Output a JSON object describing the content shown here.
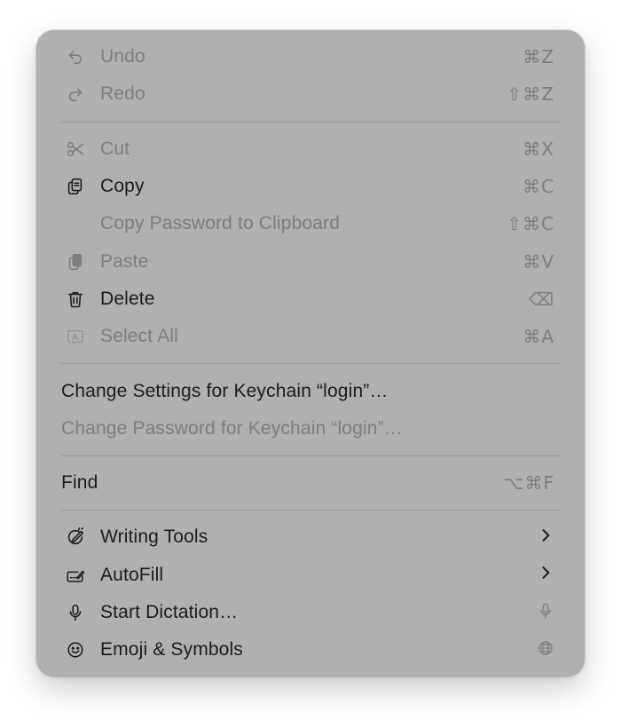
{
  "menu": {
    "groups": [
      {
        "items": [
          {
            "label": "Undo",
            "shortcut": "⌘Z",
            "icon": "undo-icon",
            "enabled": false
          },
          {
            "label": "Redo",
            "shortcut": "⇧⌘Z",
            "icon": "redo-icon",
            "enabled": false
          }
        ]
      },
      {
        "items": [
          {
            "label": "Cut",
            "shortcut": "⌘X",
            "icon": "scissors-icon",
            "enabled": false
          },
          {
            "label": "Copy",
            "shortcut": "⌘C",
            "icon": "copy-icon",
            "enabled": true
          },
          {
            "label": "Copy Password to Clipboard",
            "shortcut": "⇧⌘C",
            "icon": "",
            "enabled": false
          },
          {
            "label": "Paste",
            "shortcut": "⌘V",
            "icon": "paste-icon",
            "enabled": false
          },
          {
            "label": "Delete",
            "shortcut": "⌫",
            "icon": "trash-icon",
            "enabled": true
          },
          {
            "label": "Select All",
            "shortcut": "⌘A",
            "icon": "select-all-icon",
            "enabled": false
          }
        ]
      },
      {
        "items": [
          {
            "label": "Change Settings for Keychain “login”…",
            "shortcut": "",
            "icon": "",
            "enabled": true,
            "noicon": true
          },
          {
            "label": "Change Password for Keychain “login”…",
            "shortcut": "",
            "icon": "",
            "enabled": false,
            "noicon": true
          }
        ]
      },
      {
        "items": [
          {
            "label": "Find",
            "shortcut": "⌥⌘F",
            "icon": "",
            "enabled": true,
            "noicon": true
          }
        ]
      },
      {
        "items": [
          {
            "label": "Writing Tools",
            "shortcut": "",
            "icon": "writing-tools-icon",
            "enabled": true,
            "submenu": true
          },
          {
            "label": "AutoFill",
            "shortcut": "",
            "icon": "autofill-icon",
            "enabled": true,
            "submenu": true
          },
          {
            "label": "Start Dictation…",
            "shortcut": "",
            "icon": "microphone-icon",
            "enabled": true,
            "trailing_icon": "microphone-icon"
          },
          {
            "label": "Emoji & Symbols",
            "shortcut": "",
            "icon": "smiley-icon",
            "enabled": true,
            "trailing_icon": "globe-icon"
          }
        ]
      }
    ]
  }
}
